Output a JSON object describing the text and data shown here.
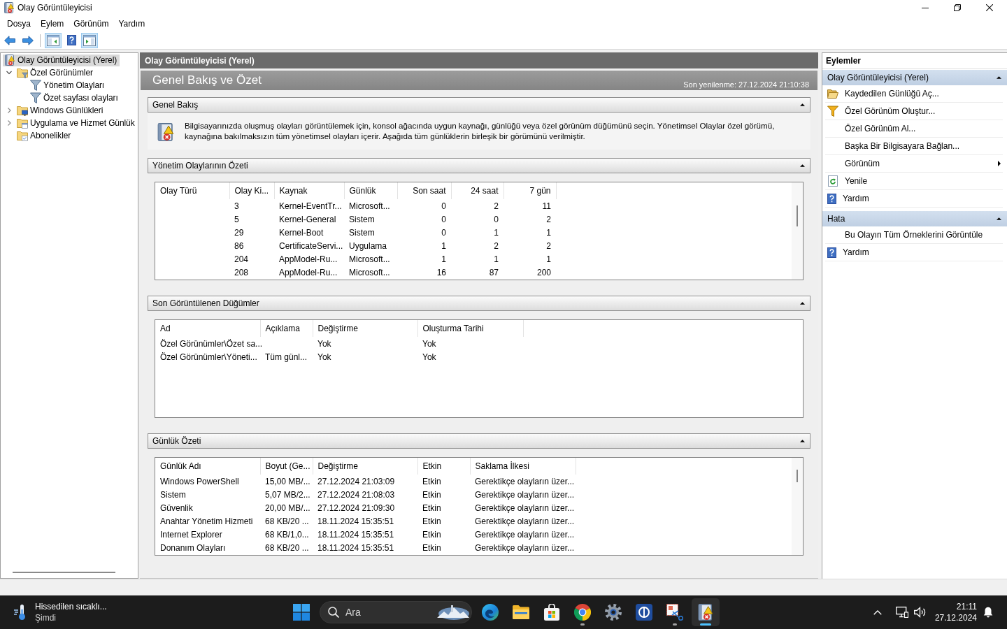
{
  "window": {
    "title": "Olay Görüntüleyicisi"
  },
  "menu": [
    "Dosya",
    "Eylem",
    "Görünüm",
    "Yardım"
  ],
  "toolbar": [
    [
      {
        "kind": "back",
        "on": false
      },
      {
        "kind": "forward",
        "on": false
      }
    ],
    [
      {
        "kind": "tree",
        "on": true
      },
      {
        "kind": "help",
        "on": false
      },
      {
        "kind": "actions",
        "on": true
      }
    ]
  ],
  "tree": [
    {
      "label": "Olay Görüntüleyicisi (Yerel)",
      "kind": "viewer",
      "selected": true,
      "children": [
        {
          "label": "Özel Görünümler",
          "kind": "views",
          "selected": false,
          "expanded": true,
          "children": [
            {
              "label": "Yönetim Olayları",
              "kind": "filter",
              "selected": false
            },
            {
              "label": "Özet sayfası olayları",
              "kind": "filter",
              "selected": false
            }
          ]
        },
        {
          "label": "Windows Günlükleri",
          "kind": "logs",
          "selected": false,
          "expanded": false
        },
        {
          "label": "Uygulama ve Hizmet Günlük",
          "kind": "services",
          "selected": false,
          "expanded": false
        },
        {
          "label": "Abonelikler",
          "kind": "subscriptions",
          "selected": false
        }
      ]
    }
  ],
  "panel": {
    "title": "Olay Görüntüleyicisi (Yerel)",
    "heading": "Genel Bakış ve Özet",
    "refreshed": "Son yenilenme: 27.12.2024 21:10:38",
    "sections": [
      {
        "title": "Genel Bakış",
        "expanded": true,
        "kind": "text",
        "text": "Bilgisayarınızda oluşmuş olayları görüntülemek için, konsol ağacında uygun kaynağı, günlüğü veya özel görünüm düğümünü seçin. Yönetimsel Olaylar özel görümü, kaynağına bakılmaksızın tüm yönetimsel olayları içerir. Aşağıda tüm günlüklerin birleşik bir görümünü verilmiştir."
      },
      {
        "title": "Yönetim Olaylarının Özeti",
        "expanded": true,
        "kind": "table",
        "columns": [
          {
            "label": "Olay Türü",
            "kind": "text"
          },
          {
            "label": "Olay Ki...",
            "kind": "text"
          },
          {
            "label": "Kaynak",
            "kind": "text"
          },
          {
            "label": "Günlük",
            "kind": "text"
          },
          {
            "label": "Son saat",
            "kind": "number"
          },
          {
            "label": "24 saat",
            "kind": "number"
          },
          {
            "label": "7 gün",
            "kind": "number"
          }
        ],
        "rows": [
          [
            "",
            "3",
            "Kernel-EventTr...",
            "Microsoft...",
            "0",
            "2",
            "11"
          ],
          [
            "",
            "5",
            "Kernel-General",
            "Sistem",
            "0",
            "0",
            "2"
          ],
          [
            "",
            "29",
            "Kernel-Boot",
            "Sistem",
            "0",
            "1",
            "1"
          ],
          [
            "",
            "86",
            "CertificateServi...",
            "Uygulama",
            "1",
            "2",
            "2"
          ],
          [
            "",
            "204",
            "AppModel-Ru...",
            "Microsoft...",
            "1",
            "1",
            "1"
          ],
          [
            "",
            "208",
            "AppModel-Ru...",
            "Microsoft...",
            "16",
            "87",
            "200"
          ]
        ]
      },
      {
        "title": "Son Görüntülenen Düğümler",
        "expanded": true,
        "kind": "table",
        "columns": [
          {
            "label": "Ad",
            "kind": "text"
          },
          {
            "label": "Açıklama",
            "kind": "text"
          },
          {
            "label": "Değiştirme",
            "kind": "text"
          },
          {
            "label": "Oluşturma Tarihi",
            "kind": "text"
          }
        ],
        "rows": [
          [
            "Özel Görünümler\\Özet sa...",
            "",
            "Yok",
            "Yok"
          ],
          [
            "Özel Görünümler\\Yöneti...",
            "Tüm günl...",
            "Yok",
            "Yok"
          ]
        ]
      },
      {
        "title": "Günlük Özeti",
        "expanded": true,
        "kind": "table",
        "columns": [
          {
            "label": "Günlük Adı",
            "kind": "text"
          },
          {
            "label": "Boyut (Ge...",
            "kind": "text"
          },
          {
            "label": "Değiştirme",
            "kind": "text"
          },
          {
            "label": "Etkin",
            "kind": "text"
          },
          {
            "label": "Saklama İlkesi",
            "kind": "text"
          }
        ],
        "rows": [
          [
            "Windows PowerShell",
            "15,00 MB/...",
            "27.12.2024 21:03:09",
            "Etkin",
            "Gerektikçe olayların üzer..."
          ],
          [
            "Sistem",
            "5,07 MB/2...",
            "27.12.2024 21:08:03",
            "Etkin",
            "Gerektikçe olayların üzer..."
          ],
          [
            "Güvenlik",
            "20,00 MB/...",
            "27.12.2024 21:09:30",
            "Etkin",
            "Gerektikçe olayların üzer..."
          ],
          [
            "Anahtar Yönetim Hizmeti",
            "68 KB/20 ...",
            "18.11.2024 15:35:51",
            "Etkin",
            "Gerektikçe olayların üzer..."
          ],
          [
            "Internet Explorer",
            "68 KB/1,0...",
            "18.11.2024 15:35:51",
            "Etkin",
            "Gerektikçe olayların üzer..."
          ],
          [
            "Donanım Olayları",
            "68 KB/20 ...",
            "18.11.2024 15:35:51",
            "Etkin",
            "Gerektikçe olayların üzer..."
          ]
        ]
      }
    ]
  },
  "actions": {
    "title": "Eylemler",
    "groups": [
      {
        "title": "Olay Görüntüleyicisi (Yerel)",
        "expanded": true,
        "items": [
          {
            "label": "Kaydedilen Günlüğü Aç...",
            "kind": "open"
          },
          {
            "label": "Özel Görünüm Oluştur...",
            "kind": "filter"
          },
          {
            "label": "Özel Görünüm Al...",
            "kind": "plain"
          },
          {
            "label": "Başka Bir Bilgisayara Bağlan...",
            "kind": "plain"
          },
          {
            "label": "Görünüm",
            "kind": "submenu"
          },
          {
            "label": "Yenile",
            "kind": "refresh"
          },
          {
            "label": "Yardım",
            "kind": "help"
          }
        ]
      },
      {
        "title": "Hata",
        "expanded": true,
        "items": [
          {
            "label": "Bu Olayın Tüm Örneklerini Görüntüle",
            "kind": "plain"
          },
          {
            "label": "Yardım",
            "kind": "help"
          }
        ]
      }
    ]
  },
  "taskbar": {
    "weather": {
      "title": "Hissedilen sıcaklı...",
      "subtitle": "Şimdi"
    },
    "search": {
      "placeholder": "Ara"
    },
    "apps": [
      {
        "kind": "browser",
        "running": false,
        "selected": false
      },
      {
        "kind": "files",
        "running": false,
        "selected": false
      },
      {
        "kind": "store",
        "running": false,
        "selected": false
      },
      {
        "kind": "web",
        "running": true,
        "selected": false
      },
      {
        "kind": "settings",
        "running": false,
        "selected": false
      },
      {
        "kind": "remote",
        "running": false,
        "selected": false
      },
      {
        "kind": "tools",
        "running": true,
        "selected": false
      },
      {
        "kind": "viewer",
        "running": true,
        "selected": true
      }
    ],
    "clock": {
      "time": "21:11",
      "date": "27.12.2024"
    }
  }
}
